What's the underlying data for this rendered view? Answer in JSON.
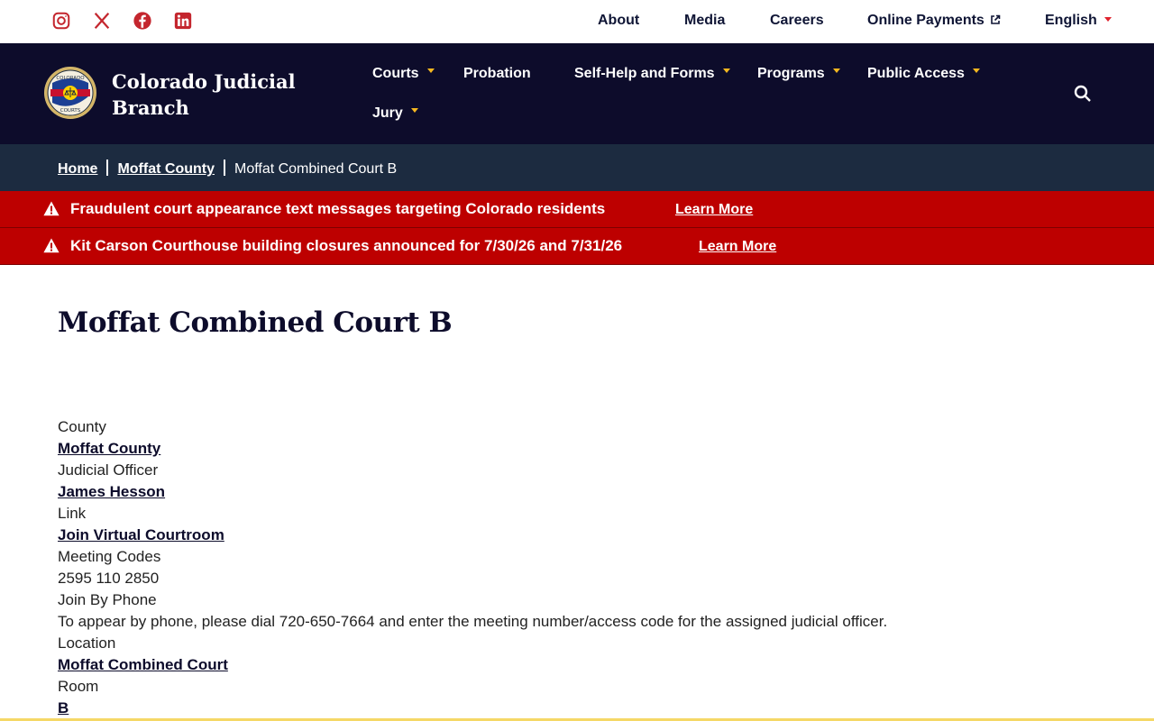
{
  "utility_nav": {
    "social": [
      "instagram-icon",
      "x-icon",
      "facebook-icon",
      "linkedin-icon"
    ],
    "links": [
      "About",
      "Media",
      "Careers",
      "Online Payments",
      "English"
    ]
  },
  "header": {
    "brand_line1": "Colorado Judicial",
    "brand_line2": "Branch",
    "seal_text_top": "COLORADO",
    "seal_text_bottom": "COURTS",
    "nav": [
      "Courts",
      "Probation",
      "Self-Help and Forms",
      "Programs",
      "Public Access",
      "Jury"
    ]
  },
  "breadcrumb": {
    "home": "Home",
    "county": "Moffat County",
    "current": "Moffat Combined Court B"
  },
  "alerts": [
    {
      "message": "Fraudulent court appearance text messages targeting Colorado residents",
      "link": "Learn More"
    },
    {
      "message": "Kit Carson Courthouse building closures announced for 7/30/26 and 7/31/26",
      "link": "Learn More"
    }
  ],
  "page": {
    "title": "Moffat Combined Court B",
    "fields": [
      {
        "label": "County",
        "value": "Moffat County"
      },
      {
        "label": "Judicial Officer",
        "value": "James Hesson"
      },
      {
        "label": "Link",
        "value": "Join Virtual Courtroom"
      },
      {
        "label": "Meeting Codes",
        "value": "2595 110 2850"
      },
      {
        "label": "Join By Phone",
        "value": "To appear by phone, please dial 720-650-7664 and enter the meeting number/access code for the assigned judicial officer."
      },
      {
        "label": "Location",
        "value": "Moffat Combined Court"
      },
      {
        "label": "Room",
        "value": "B"
      }
    ]
  },
  "colors": {
    "navy": "#0d0c2b",
    "breadcrumb_bg": "#1c2b40",
    "alert_red": "#bd0000",
    "accent_gold": "#f5b820",
    "social_red": "#c4262e"
  }
}
